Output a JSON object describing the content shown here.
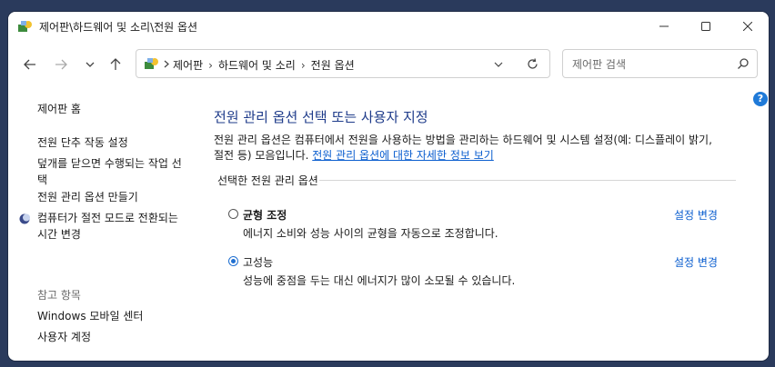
{
  "window": {
    "title": "제어판\\하드웨어 및 소리\\전원 옵션",
    "minimize_icon": "minimize-icon",
    "maximize_icon": "maximize-icon",
    "close_icon": "close-icon"
  },
  "nav": {
    "breadcrumbs": [
      "제어판",
      "하드웨어 및 소리",
      "전원 옵션"
    ],
    "search_placeholder": "제어판 검색"
  },
  "sidebar": {
    "home": "제어판 홈",
    "links": [
      "전원 단추 작동 설정",
      "덮개를 닫으면 수행되는 작업 선택",
      "전원 관리 옵션 만들기",
      "컴퓨터가 절전 모드로 전환되는 시간 변경"
    ],
    "see_also_label": "참고 항목",
    "see_also": [
      "Windows 모바일 센터",
      "사용자 계정"
    ]
  },
  "main": {
    "title": "전원 관리 옵션 선택 또는 사용자 지정",
    "description": "전원 관리 옵션은 컴퓨터에서 전원을 사용하는 방법을 관리하는 하드웨어 및 시스템 설정(예: 디스플레이 밝기, 절전 등) 모음입니다. ",
    "description_link": "전원 관리 옵션에 대한 자세한 정보 보기",
    "group_label": "선택한 전원 관리 옵션",
    "plans": [
      {
        "name": "균형 조정",
        "desc": "에너지 소비와 성능 사이의 균형을 자동으로 조정합니다.",
        "change": "설정 변경",
        "selected": false
      },
      {
        "name": "고성능",
        "desc": "성능에 중점을 두는 대신 에너지가 많이 소모될 수 있습니다.",
        "change": "설정 변경",
        "selected": true
      }
    ]
  },
  "colors": {
    "accent": "#1f6fd1",
    "link": "#0b5ecf",
    "title": "#1e3b8a"
  }
}
